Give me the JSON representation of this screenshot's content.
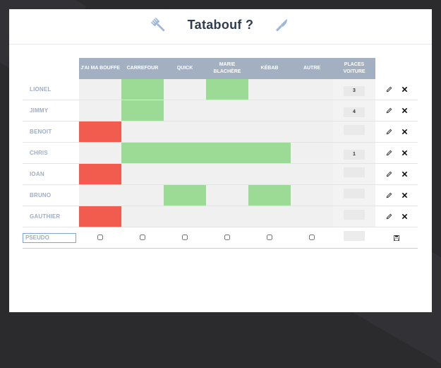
{
  "app": {
    "title": "Tatabouf ?"
  },
  "icons": {
    "left": "fork-icon",
    "right": "knife-icon"
  },
  "colors": {
    "yes": "#9bdb96",
    "no": "#f15c4f",
    "empty": "#f0f0f0",
    "header": "#a3b0c1"
  },
  "table": {
    "columns": [
      "J'AI MA BOUFFE",
      "CARREFOUR",
      "QUICK",
      "MARIE BLACHÈRE",
      "KÉBAB",
      "AUTRE",
      "PLACES VOITURE"
    ],
    "rows": [
      {
        "name": "LIONEL",
        "choices": [
          "",
          "yes",
          "",
          "yes",
          "",
          ""
        ],
        "places": "3"
      },
      {
        "name": "JIMMY",
        "choices": [
          "",
          "yes",
          "",
          "",
          "",
          ""
        ],
        "places": "4"
      },
      {
        "name": "BENOIT",
        "choices": [
          "no",
          "",
          "",
          "",
          "",
          ""
        ],
        "places": ""
      },
      {
        "name": "CHRIS",
        "choices": [
          "",
          "yes",
          "yes",
          "yes",
          "yes",
          ""
        ],
        "places": "1"
      },
      {
        "name": "IOAN",
        "choices": [
          "no",
          "",
          "",
          "",
          "",
          ""
        ],
        "places": ""
      },
      {
        "name": "BRUNO",
        "choices": [
          "",
          "",
          "yes",
          "",
          "yes",
          ""
        ],
        "places": ""
      },
      {
        "name": "GAUTHIER",
        "choices": [
          "no",
          "",
          "",
          "",
          "",
          ""
        ],
        "places": ""
      }
    ],
    "actions": {
      "edit": "pencil-icon",
      "delete": "close-icon"
    }
  },
  "new_entry": {
    "placeholder": "PSEUDO",
    "save": "save-icon"
  }
}
